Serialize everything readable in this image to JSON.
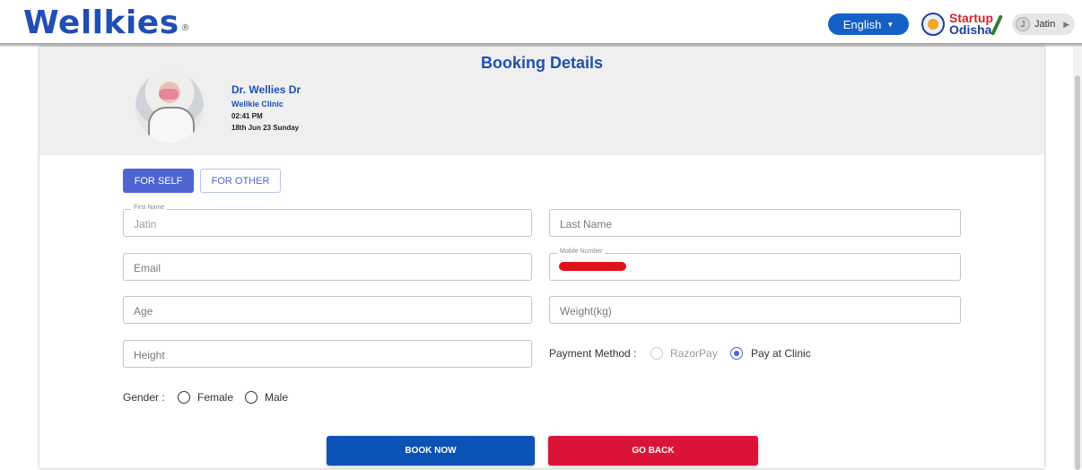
{
  "header": {
    "logo_text": "Wellkies",
    "logo_mark": "®",
    "language_label": "English",
    "startup_line1": "Startup",
    "startup_line2": "Odisha",
    "user_initial": "J",
    "user_name": "Jatin"
  },
  "booking": {
    "title": "Booking Details",
    "doctor_name": "Dr. Wellies Dr",
    "clinic": "Wellkie Clinic",
    "time": "02:41 PM",
    "date": "18th Jun 23 Sunday"
  },
  "tabs": {
    "self": "FOR SELF",
    "other": "FOR OTHER",
    "active": "self"
  },
  "form": {
    "first_name_label": "First Name",
    "first_name_value": "Jatin",
    "last_name_placeholder": "Last Name",
    "email_placeholder": "Email",
    "mobile_label": "Mobile Number",
    "age_placeholder": "Age",
    "weight_placeholder": "Weight(kg)",
    "height_placeholder": "Height",
    "payment_label": "Payment Method :",
    "payment_options": [
      "RazorPay",
      "Pay at Clinic"
    ],
    "payment_selected": "Pay at Clinic",
    "gender_label": "Gender :",
    "gender_options": [
      "Female",
      "Male"
    ]
  },
  "actions": {
    "book_now": "BOOK NOW",
    "go_back": "GO BACK"
  },
  "colors": {
    "brand_blue": "#1f4fb3",
    "tab_active": "#4d64d2",
    "book_button": "#0a52b5",
    "back_button": "#dc1339"
  }
}
